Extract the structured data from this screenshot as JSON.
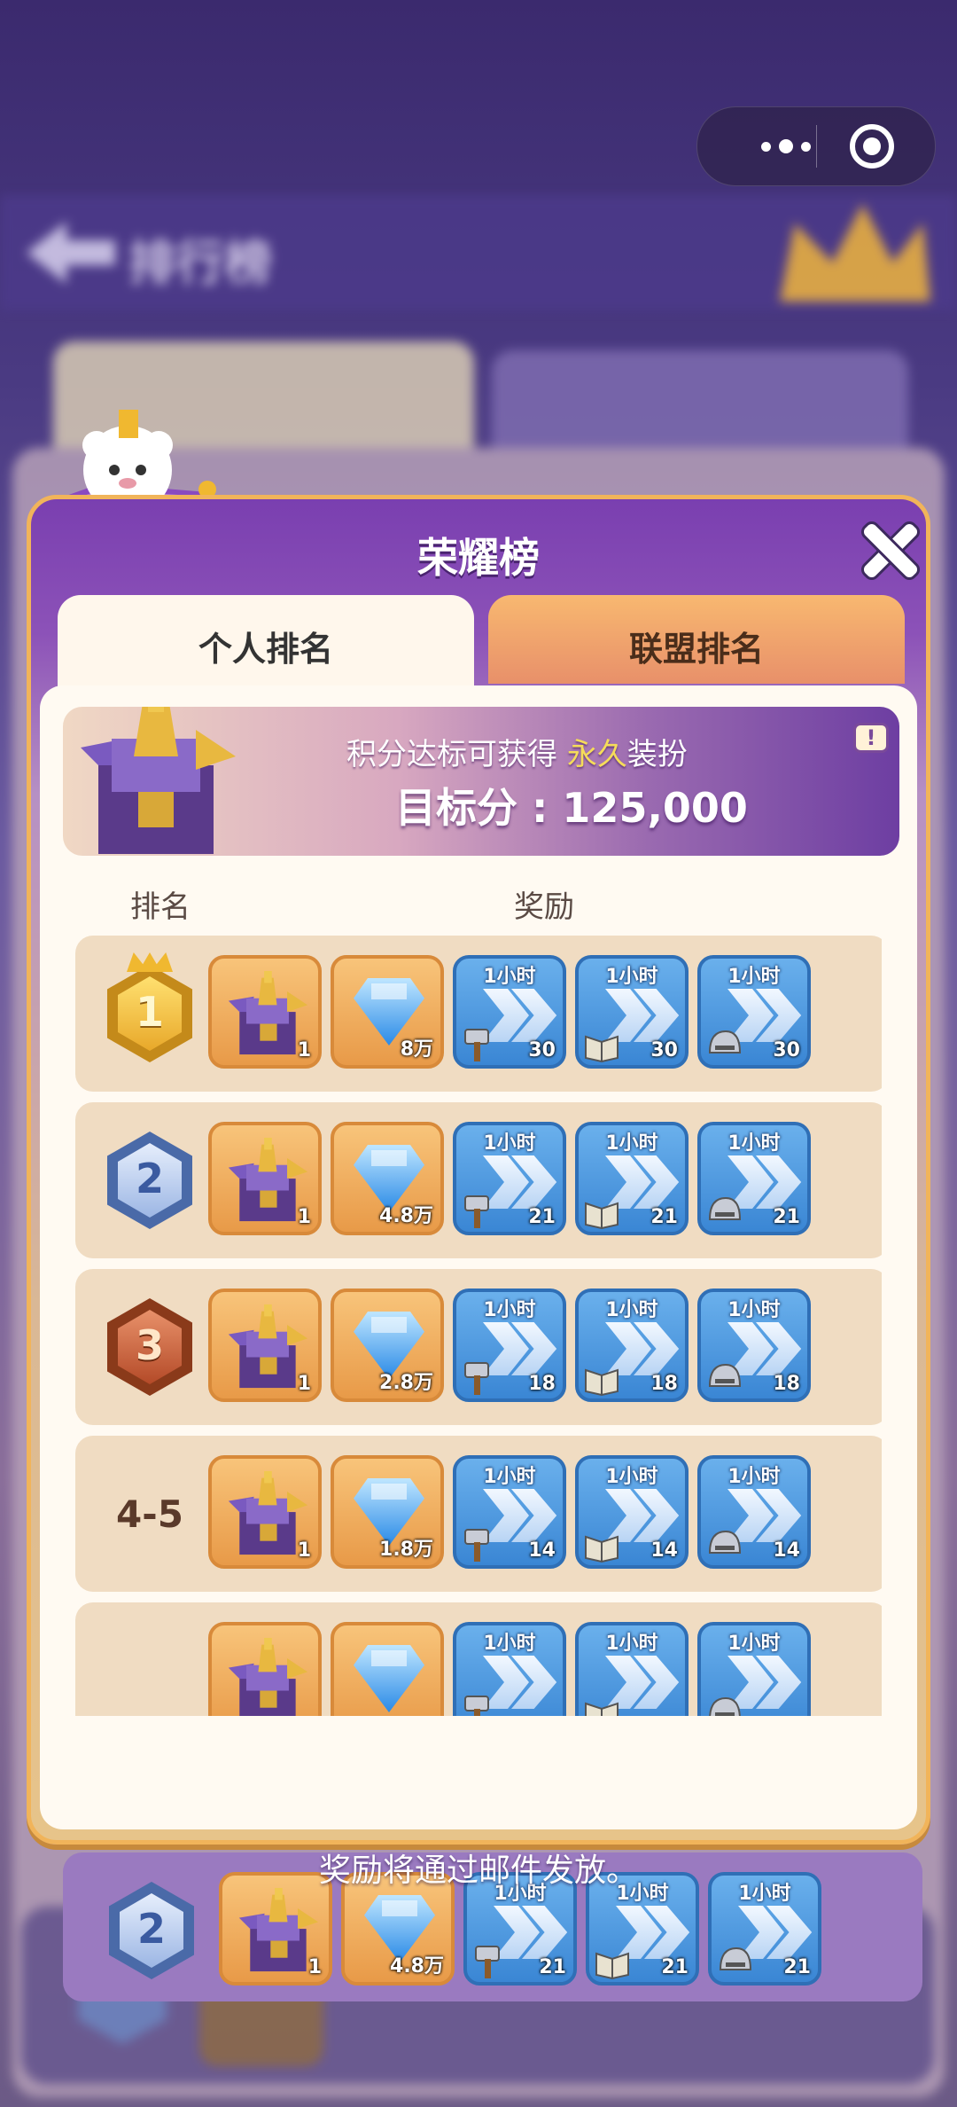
{
  "background": {
    "title": "排行榜"
  },
  "dialog": {
    "title": "荣耀榜",
    "tabs": [
      {
        "label": "个人排名",
        "active": true
      },
      {
        "label": "联盟排名",
        "active": false
      }
    ],
    "banner": {
      "line1_prefix": "积分达标可获得",
      "line1_highlight": "永久",
      "line1_suffix": "装扮",
      "target_label": "目标分 : 125,000",
      "info_icon": "!"
    },
    "columns": {
      "rank": "排名",
      "reward": "奖励"
    },
    "rows": [
      {
        "rank": "1",
        "rank_type": "gold",
        "castle_qty": "1",
        "gem_qty": "8万",
        "boost_label": "1小时",
        "boost_qty": "30"
      },
      {
        "rank": "2",
        "rank_type": "silver",
        "castle_qty": "1",
        "gem_qty": "4.8万",
        "boost_label": "1小时",
        "boost_qty": "21"
      },
      {
        "rank": "3",
        "rank_type": "bronze",
        "castle_qty": "1",
        "gem_qty": "2.8万",
        "boost_label": "1小时",
        "boost_qty": "18"
      },
      {
        "rank": "4-5",
        "rank_type": "text",
        "castle_qty": "1",
        "gem_qty": "1.8万",
        "boost_label": "1小时",
        "boost_qty": "14"
      },
      {
        "rank": "",
        "rank_type": "text",
        "castle_qty": "",
        "gem_qty": "",
        "boost_label": "1小时",
        "boost_qty": ""
      }
    ],
    "my_rank": {
      "rank": "2",
      "castle_qty": "1",
      "gem_qty": "4.8万",
      "boost_label": "1小时",
      "boost_qty": "21"
    }
  },
  "footer": {
    "note": "奖励将通过邮件发放。"
  },
  "colors": {
    "accent_purple": "#7a3fb0",
    "border_gold": "#f1b45a",
    "row_bg": "#f0dcc2",
    "my_row_bg": "#9a7ac0"
  }
}
